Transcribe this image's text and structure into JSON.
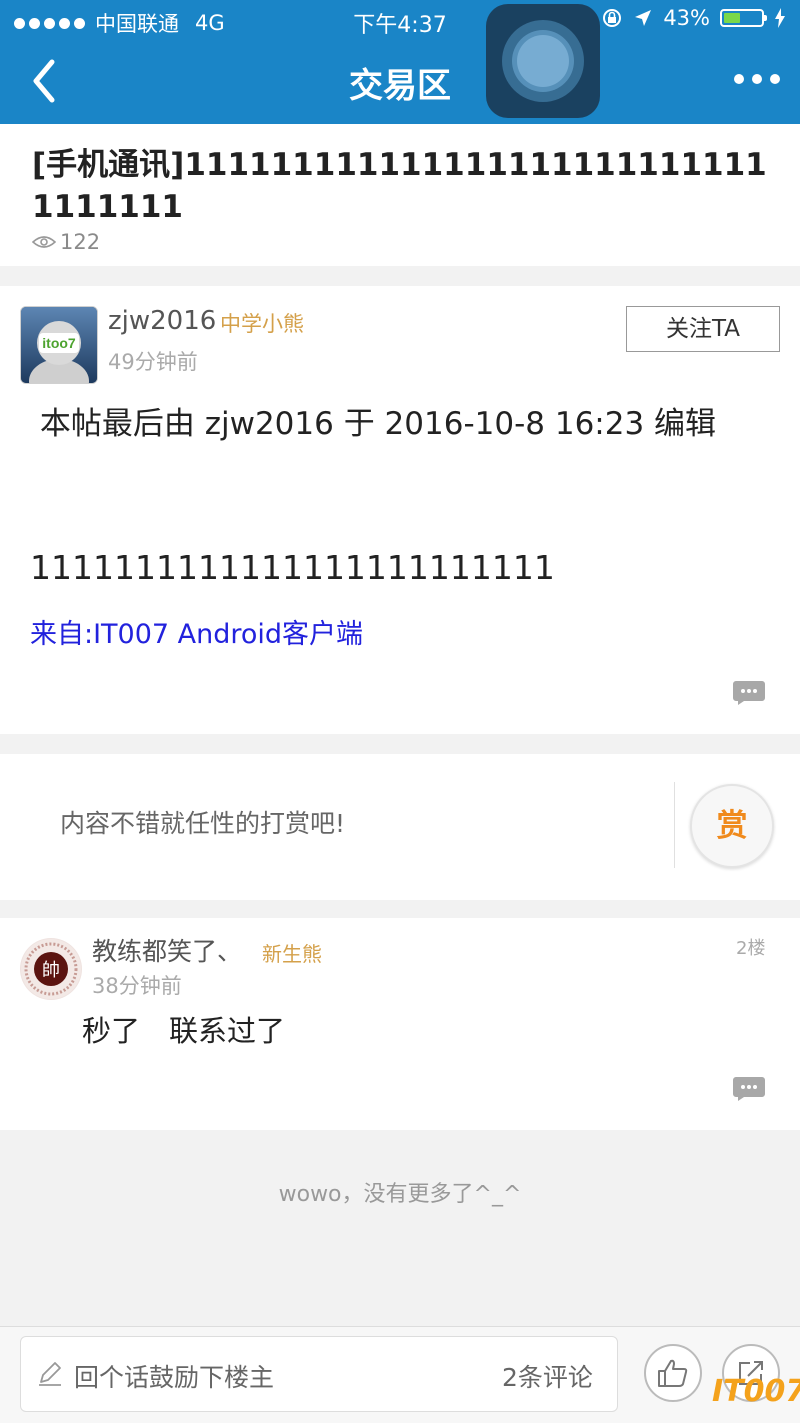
{
  "status_bar": {
    "carrier": "中国联通",
    "network": "4G",
    "time": "下午4:37",
    "battery": "43%"
  },
  "nav": {
    "title": "交易区"
  },
  "thread": {
    "title": "[手机通讯]1111111111111111111111111111111111",
    "views": "122"
  },
  "post": {
    "author": "zjw2016",
    "level": "中学小熊",
    "time": "49分钟前",
    "follow_label": "关注TA",
    "edit_note": " 本帖最后由 zjw2016 于 2016-10-8 16:23 编辑",
    "body": "1111111111111111111111111",
    "source": "来自:IT007 Android客户端",
    "avatar_text": "itoo7"
  },
  "tip": {
    "prompt": "内容不错就任性的打赏吧!",
    "button": "赏"
  },
  "reply": {
    "author": "教练都笑了、",
    "level": "新生熊",
    "time": "38分钟前",
    "floor": "2楼",
    "text": "秒了　联系过了",
    "avatar_char": "帥"
  },
  "footer": {
    "end_text": "wowo，没有更多了^_^"
  },
  "bottom": {
    "placeholder": "回个话鼓励下楼主",
    "comment_count": "2条评论",
    "watermark": "IT007"
  },
  "colors": {
    "brand": "#1a85c7",
    "level": "#d4a04a",
    "link": "#2222dd",
    "tip": "#f08a1c"
  }
}
